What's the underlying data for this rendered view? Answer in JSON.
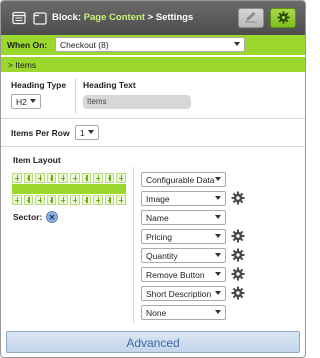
{
  "header": {
    "prefix": "Block:",
    "block_name": "Page Content",
    "separator": ">",
    "page": "Settings"
  },
  "when_on": {
    "label": "When On:",
    "value": "Checkout (8)"
  },
  "items_bar": {
    "label": "> Items"
  },
  "heading": {
    "type_label": "Heading Type",
    "type_value": "H2",
    "text_label": "Heading Text",
    "text_value": "Items"
  },
  "items_per_row": {
    "label": "Items Per Row",
    "value": "1"
  },
  "item_layout": {
    "label": "Item Layout",
    "sector_label": "Sector:",
    "fields": [
      {
        "value": "Configurable Data",
        "has_settings": false
      },
      {
        "value": "Image",
        "has_settings": true
      },
      {
        "value": "Name",
        "has_settings": false
      },
      {
        "value": "Pricing",
        "has_settings": true
      },
      {
        "value": "Quantity",
        "has_settings": true
      },
      {
        "value": "Remove Button",
        "has_settings": true
      },
      {
        "value": "Short Description",
        "has_settings": true
      },
      {
        "value": "None",
        "has_settings": false
      }
    ]
  },
  "footer": {
    "advanced_label": "Advanced"
  },
  "colors": {
    "accent_green": "#9bd72d",
    "header_gray": "#5a5a5a",
    "advanced_blue": "#3d6aa3"
  },
  "icons": {
    "header_left": "list-icon",
    "header_block": "square-icon",
    "edit": "pencil-icon",
    "settings": "gear-icon",
    "sector_remove": "close-icon",
    "field_settings": "gear-icon"
  }
}
